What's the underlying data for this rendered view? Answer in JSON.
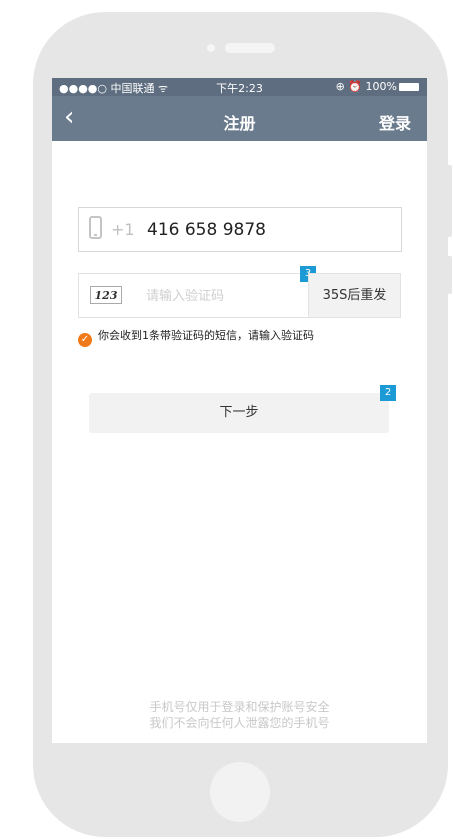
{
  "statusbar": {
    "carrier": "●●●●○ 中国联通 ",
    "wifi_icon": "wifi-icon",
    "time": "下午2:23",
    "right": "⊕ ⏰ 100%"
  },
  "navbar": {
    "back_icon": "‹",
    "title": "注册",
    "login": "登录"
  },
  "phone_field": {
    "country_code": "+1",
    "number": "416 658 9878"
  },
  "code_field": {
    "captcha": "123",
    "placeholder": "请输入验证码",
    "badge": "3"
  },
  "resend": {
    "label": "35S后重发"
  },
  "hint": {
    "text": "你会收到1条带验证码的短信，请输入验证码"
  },
  "next": {
    "label": "下一步",
    "badge": "2"
  },
  "footer": {
    "line1": "手机号仅用于登录和保护账号安全",
    "line2": "我们不会向任何人泄露您的手机号"
  },
  "colors": {
    "navbar": "#6a7b8d",
    "statusbar": "#5e6e80",
    "accent": "#f07a1a",
    "badge": "#1b9ad6"
  }
}
